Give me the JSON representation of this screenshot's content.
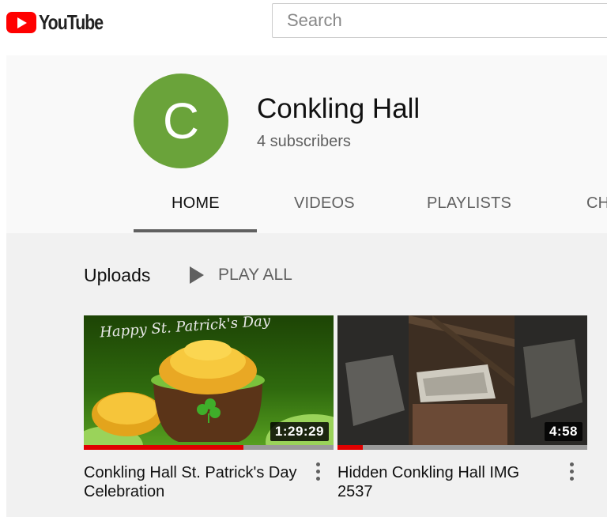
{
  "header": {
    "logo_text": "YouTube",
    "search_placeholder": "Search"
  },
  "channel": {
    "avatar_letter": "C",
    "name": "Conkling Hall",
    "subscribers": "4 subscribers",
    "avatar_color": "#6aa33a"
  },
  "tabs": [
    {
      "label": "HOME",
      "active": true
    },
    {
      "label": "VIDEOS",
      "active": false
    },
    {
      "label": "PLAYLISTS",
      "active": false
    },
    {
      "label": "CH",
      "active": false
    }
  ],
  "uploads": {
    "title": "Uploads",
    "play_all": "PLAY ALL"
  },
  "videos": [
    {
      "title": "Conkling Hall St. Patrick's Day Celebration",
      "duration": "1:29:29",
      "watched_fraction": 0.64,
      "thumbnail_text": "Happy St. Patrick's Day"
    },
    {
      "title": "Hidden Conkling Hall IMG 2537",
      "duration": "4:58",
      "watched_fraction": 0.1
    }
  ]
}
